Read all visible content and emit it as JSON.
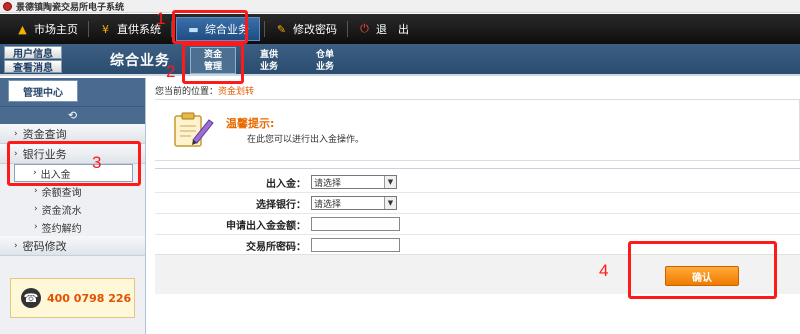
{
  "window": {
    "title": "景德镇陶瓷交易所电子系统"
  },
  "topnav": {
    "items": [
      {
        "label": "市场主页"
      },
      {
        "label": "直供系统"
      },
      {
        "label": "综合业务"
      },
      {
        "label": "修改密码"
      },
      {
        "label": "退　出"
      }
    ]
  },
  "subbar": {
    "user_info": "用户信息",
    "view_messages": "查看消息",
    "section_title": "综合业务",
    "tabs": [
      {
        "line1": "资金",
        "line2": "管理"
      },
      {
        "line1": "直供",
        "line2": "业务"
      },
      {
        "line1": "仓单",
        "line2": "业务"
      }
    ]
  },
  "sidebar": {
    "header": "管理中心",
    "groups": [
      {
        "label": "资金查询"
      },
      {
        "label": "银行业务"
      },
      {
        "label": "密码修改"
      }
    ],
    "bank_items": [
      {
        "label": "出入金"
      },
      {
        "label": "余额查询"
      },
      {
        "label": "资金流水"
      },
      {
        "label": "签约解约"
      }
    ],
    "phone": "400 0798 226"
  },
  "breadcrumb": {
    "prefix": "您当前的位置：",
    "current": "资金划转"
  },
  "tip": {
    "title": "温馨提示:",
    "text": "在此您可以进行出入金操作。"
  },
  "form": {
    "fields": [
      {
        "label": "出入金：",
        "value": "请选择"
      },
      {
        "label": "选择银行：",
        "value": "请选择"
      },
      {
        "label": "申请出入金金额：",
        "value": ""
      },
      {
        "label": "交易所密码：",
        "value": ""
      }
    ],
    "confirm": "确认"
  },
  "annotations": {
    "n1": "1",
    "n2": "2",
    "n3": "3",
    "n4": "4"
  },
  "colors": {
    "accent": "#ff1a1a",
    "nav_bg": "#1a1a1a",
    "subbar_bg": "#355878",
    "button_orange": "#f28a12"
  }
}
